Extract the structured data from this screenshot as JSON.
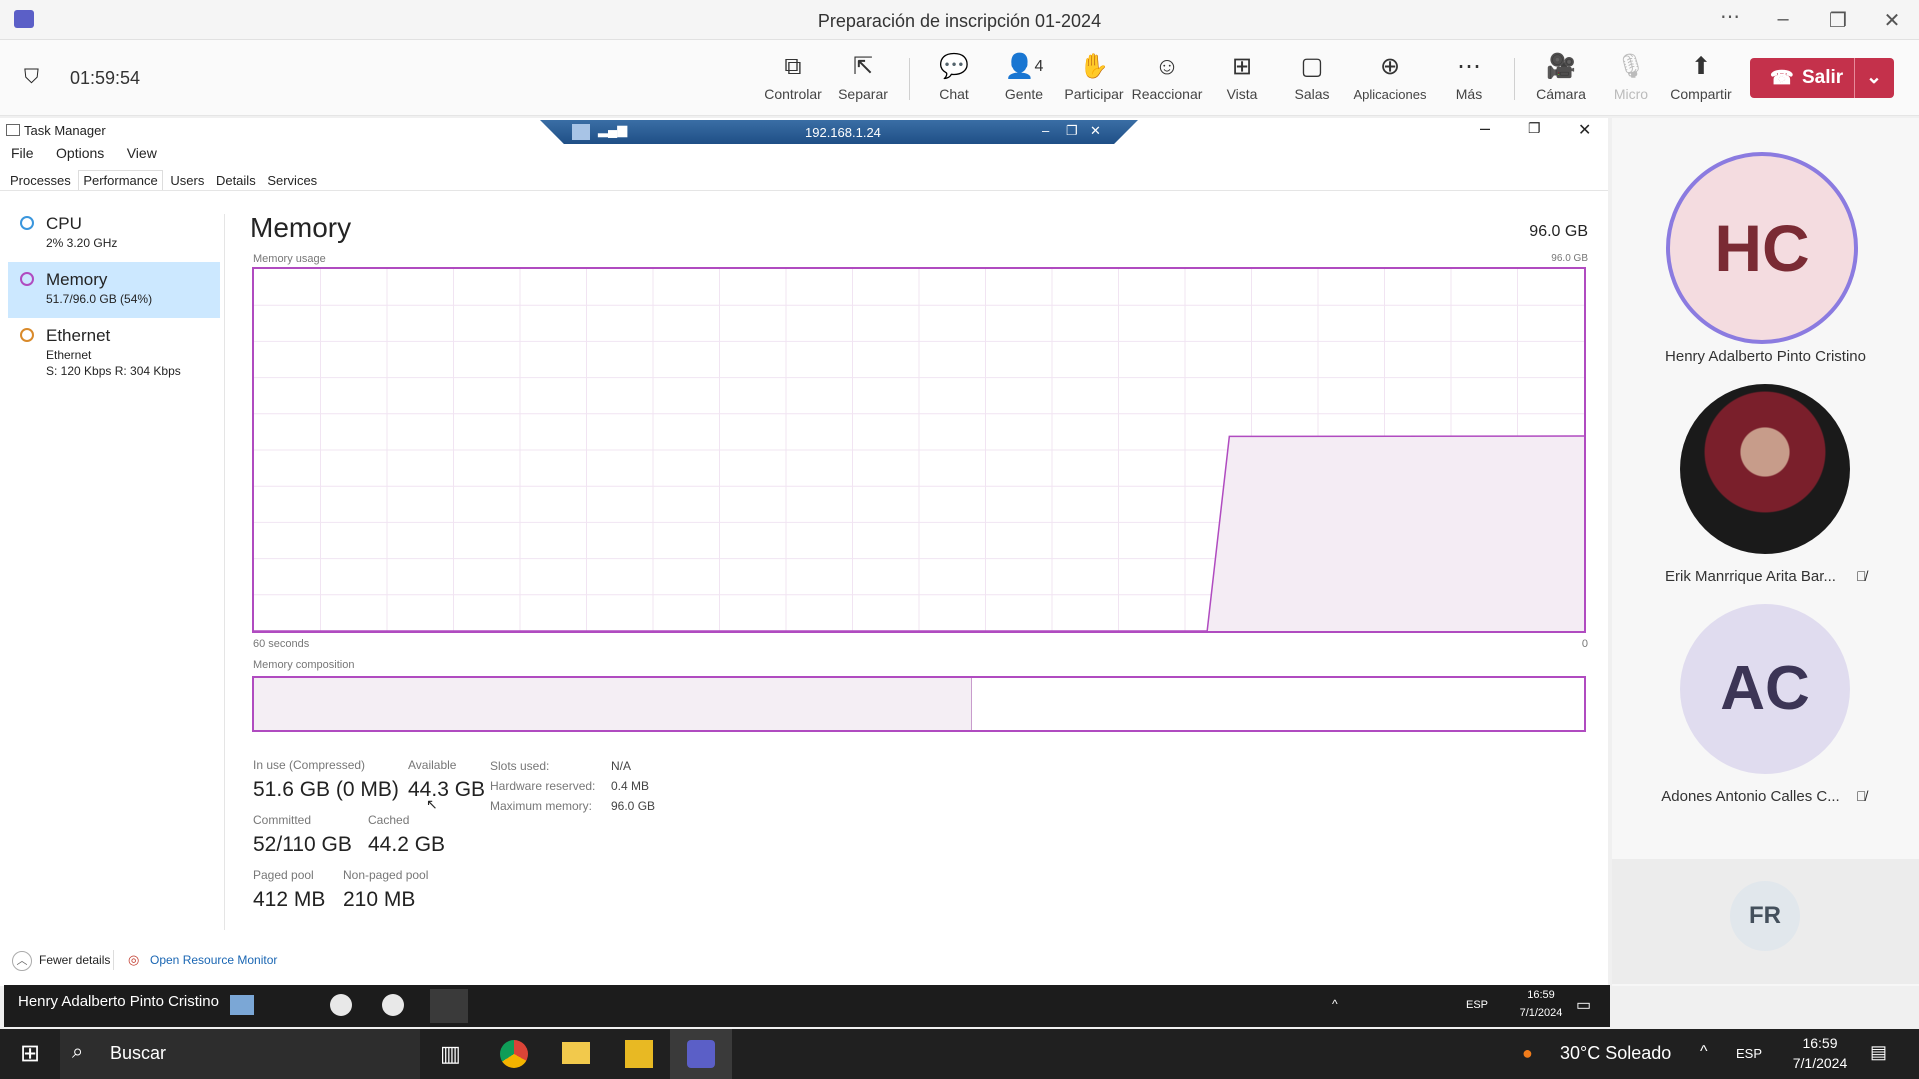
{
  "window": {
    "title": "Preparación de inscripción 01-2024"
  },
  "meeting": {
    "timer": "01:59:54",
    "toolbar": [
      {
        "id": "controlar",
        "label": "Controlar",
        "icon": "control-icon"
      },
      {
        "id": "separar",
        "label": "Separar",
        "icon": "popout-icon"
      },
      {
        "id": "chat",
        "label": "Chat",
        "icon": "chat-icon"
      },
      {
        "id": "gente",
        "label": "Gente",
        "icon": "people-icon",
        "count": "4"
      },
      {
        "id": "participar",
        "label": "Participar",
        "icon": "raise-hand-icon"
      },
      {
        "id": "reaccionar",
        "label": "Reaccionar",
        "icon": "emoji-icon"
      },
      {
        "id": "vista",
        "label": "Vista",
        "icon": "grid-icon"
      },
      {
        "id": "salas",
        "label": "Salas",
        "icon": "rooms-icon"
      },
      {
        "id": "aplicaciones",
        "label": "Aplicaciones",
        "icon": "plus-icon"
      },
      {
        "id": "mas",
        "label": "Más",
        "icon": "more-icon"
      },
      {
        "id": "camara",
        "label": "Cámara",
        "icon": "camera-off-icon"
      },
      {
        "id": "micro",
        "label": "Micro",
        "icon": "mic-off-icon"
      },
      {
        "id": "compartir",
        "label": "Compartir",
        "icon": "share-icon"
      }
    ],
    "leave_label": "Salir"
  },
  "remote": {
    "ip": "192.168.1.24"
  },
  "taskmgr": {
    "title": "Task Manager",
    "menu": [
      "File",
      "Options",
      "View"
    ],
    "tabs": [
      "Processes",
      "Performance",
      "Users",
      "Details",
      "Services"
    ],
    "active_tab": "Performance",
    "side": [
      {
        "name": "CPU",
        "sub": "2% 3.20 GHz",
        "color": "#3a96dd"
      },
      {
        "name": "Memory",
        "sub": "51.7/96.0 GB (54%)",
        "color": "#b04bc0"
      },
      {
        "name": "Ethernet",
        "sub": "Ethernet",
        "sub2": "S: 120 Kbps R: 304 Kbps",
        "color": "#d98a2b"
      }
    ],
    "heading": "Memory",
    "total": "96.0 GB",
    "usage_label": "Memory usage",
    "usage_max": "96.0 GB",
    "x_left": "60 seconds",
    "x_right": "0",
    "composition_label": "Memory composition",
    "composition_in_use_fraction": 0.54,
    "stats": {
      "in_use_label": "In use (Compressed)",
      "in_use": "51.6 GB (0 MB)",
      "available_label": "Available",
      "available": "44.3 GB",
      "committed_label": "Committed",
      "committed": "52/110 GB",
      "cached_label": "Cached",
      "cached": "44.2 GB",
      "paged_label": "Paged pool",
      "paged": "412 MB",
      "nonpaged_label": "Non-paged pool",
      "nonpaged": "210 MB",
      "slots_label": "Slots used:",
      "slots": "N/A",
      "hw_label": "Hardware reserved:",
      "hw": "0.4 MB",
      "max_label": "Maximum memory:",
      "max": "96.0 GB"
    },
    "fewer_details": "Fewer details",
    "resource_monitor": "Open Resource Monitor"
  },
  "chart_data": {
    "type": "area",
    "title": "Memory usage",
    "xlabel": "",
    "ylabel": "",
    "x_ticks": [
      "60 seconds",
      "0"
    ],
    "ylim": [
      0,
      96.0
    ],
    "series": [
      {
        "x": [
          60,
          45,
          17,
          16,
          0
        ],
        "y": [
          0,
          0,
          0,
          51.6,
          51.7
        ]
      }
    ]
  },
  "participants": [
    {
      "initials": "HC",
      "name": "Henry Adalberto Pinto Cristino",
      "bg": "#f4dce0",
      "fg": "#7a2b34",
      "speaking": true
    },
    {
      "initials": "",
      "name": "Erik Manrrique Arita Bar...",
      "photo": true,
      "muted": true
    },
    {
      "initials": "AC",
      "name": "Adones Antonio Calles C...",
      "bg": "#e0dcef",
      "fg": "#3c3556",
      "muted": true
    },
    {
      "initials": "FR",
      "name": "",
      "bg": "#e1e7ec",
      "fg": "#44505c"
    }
  ],
  "remote_taskbar": {
    "presenter": "Henry Adalberto Pinto Cristino",
    "lang": "ESP",
    "time": "16:59",
    "date": "7/1/2024"
  },
  "taskbar": {
    "search": "Buscar",
    "weather": "30°C Soleado",
    "lang": "ESP",
    "time": "16:59",
    "date": "7/1/2024"
  }
}
